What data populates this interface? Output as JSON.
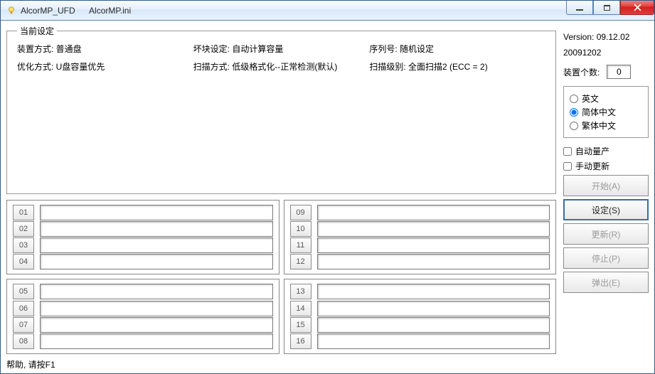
{
  "title": "AlcorMP_UFD      AlcorMP.ini",
  "settings": {
    "legend": "当前设定",
    "row1": {
      "mount_label": "装置方式: ",
      "mount_value": "普通盘",
      "bad_label": "坏块设定: ",
      "bad_value": "自动计算容量",
      "serial_label": "序列号: ",
      "serial_value": "随机设定"
    },
    "row2": {
      "opt_label": "优化方式: ",
      "opt_value": "U盘容量优先",
      "scan_label": "扫描方式: ",
      "scan_value": "低级格式化--正常检测(默认)",
      "level_label": "扫描级别: ",
      "level_value": "全面扫描2 (ECC = 2)"
    }
  },
  "right": {
    "version_label": "Version: ",
    "version_value": "09.12.02",
    "date": "20091202",
    "devcount_label": "装置个数:",
    "devcount_value": "0",
    "lang_en": "英文",
    "lang_cn": "简体中文",
    "lang_tw": "繁体中文",
    "auto_mp": "自动量产",
    "manual_up": "手动更新",
    "btn_start": "开始(A)",
    "btn_set": "设定(S)",
    "btn_refresh": "更新(R)",
    "btn_stop": "停止(P)",
    "btn_eject": "弹出(E)"
  },
  "slots": {
    "g1": [
      "01",
      "02",
      "03",
      "04"
    ],
    "g2": [
      "09",
      "10",
      "11",
      "12"
    ],
    "g3": [
      "05",
      "06",
      "07",
      "08"
    ],
    "g4": [
      "13",
      "14",
      "15",
      "16"
    ]
  },
  "help": "帮助, 请按F1"
}
